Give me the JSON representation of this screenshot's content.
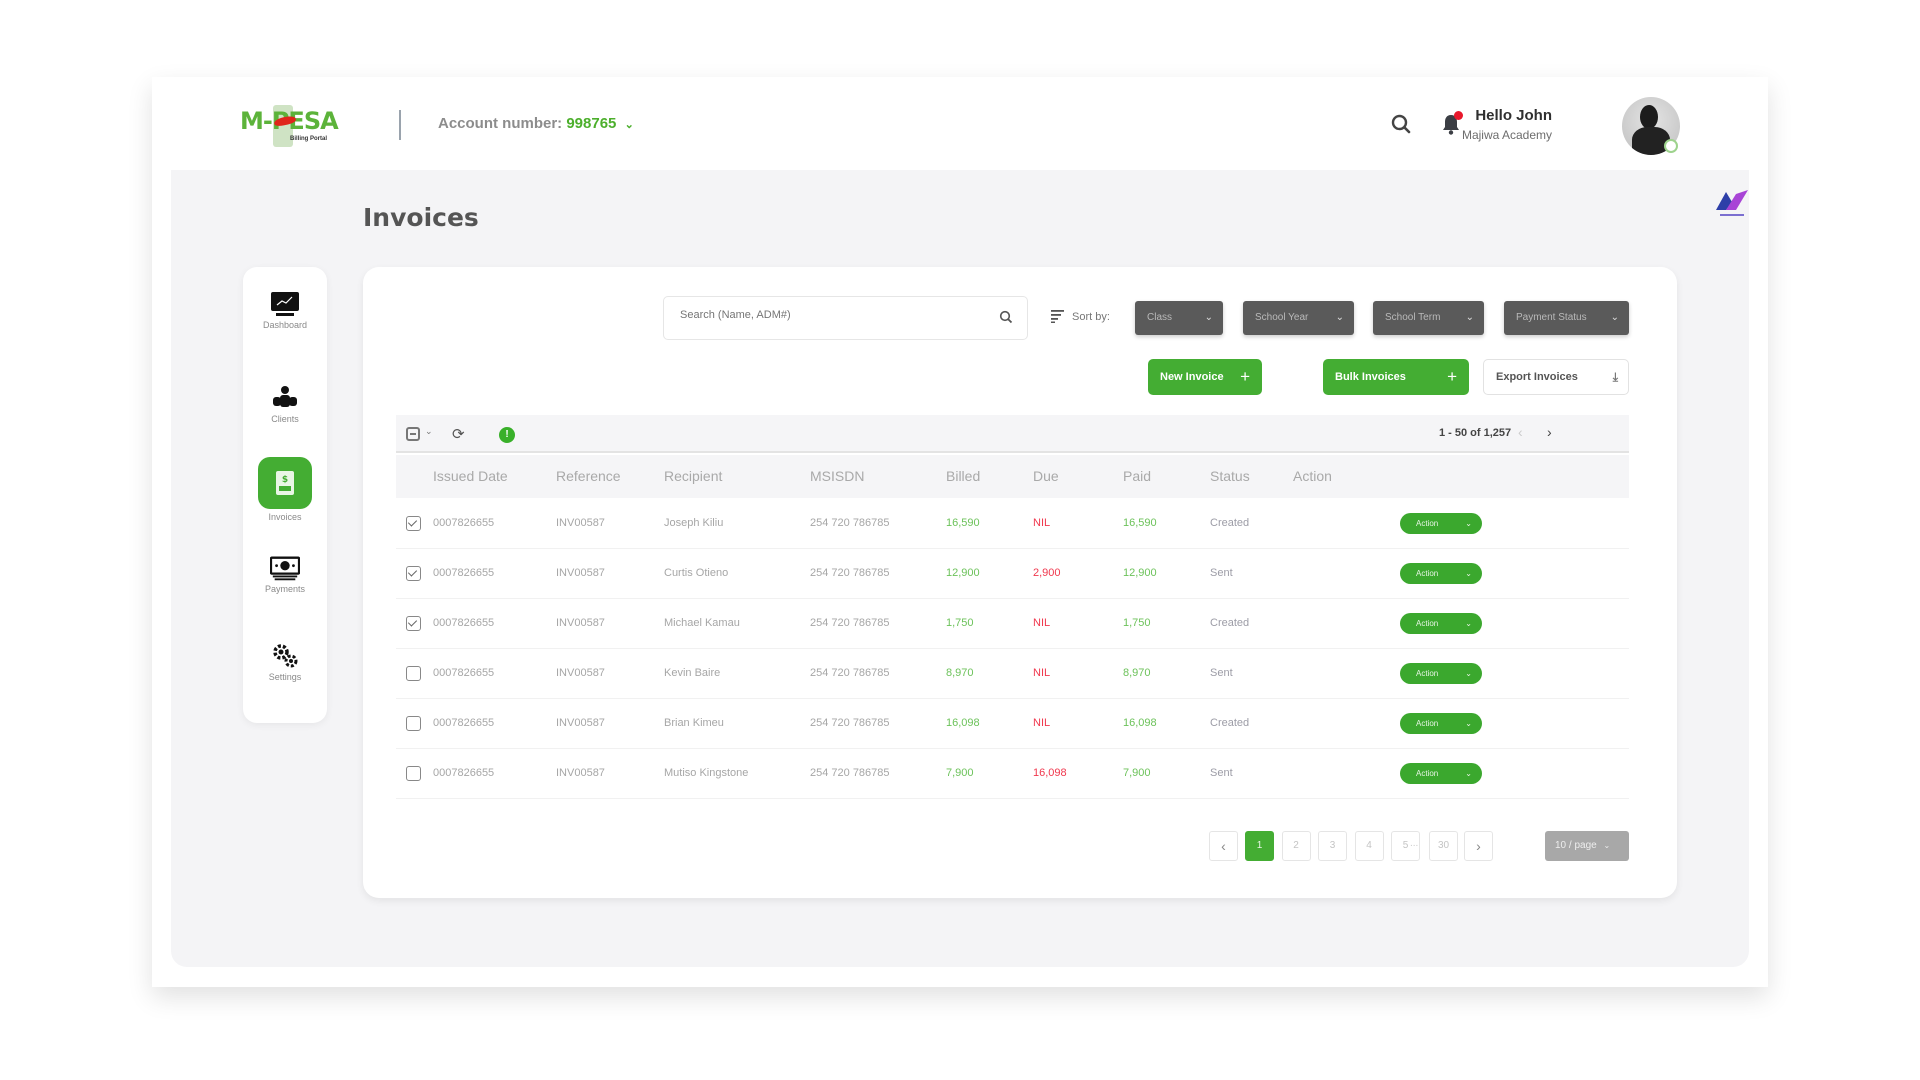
{
  "header": {
    "logo_text": "M-PESA",
    "logo_subtitle": "Billing Portal",
    "account_label": "Account number:",
    "account_number": "998765",
    "greeting": "Hello John",
    "organization": "Majiwa Academy"
  },
  "page": {
    "title": "Invoices"
  },
  "sidebar": {
    "items": [
      {
        "label": "Dashboard",
        "icon": "monitor-chart-icon",
        "active": false
      },
      {
        "label": "Clients",
        "icon": "clients-icon",
        "active": false
      },
      {
        "label": "Invoices",
        "icon": "invoice-document-icon",
        "active": true
      },
      {
        "label": "Payments",
        "icon": "cash-icon",
        "active": false
      },
      {
        "label": "Settings",
        "icon": "gears-icon",
        "active": false
      }
    ]
  },
  "toolbar": {
    "search_placeholder": "Search (Name, ADM#)",
    "sort_label": "Sort by:",
    "filters": [
      "Class",
      "School Year",
      "School Term",
      "Payment Status"
    ],
    "new_invoice": "New Invoice",
    "bulk_invoices": "Bulk Invoices",
    "export_invoices": "Export Invoices"
  },
  "table": {
    "range_text": "1 - 50 of 1,257",
    "columns": [
      "Issued Date",
      "Reference",
      "Recipient",
      "MSISDN",
      "Billed",
      "Due",
      "Paid",
      "Status",
      "Action"
    ],
    "rows": [
      {
        "checked": true,
        "date": "0007826655",
        "ref": "INV00587",
        "recipient": "Joseph Kiliu",
        "msisdn": "254 720 786785",
        "billed": "16,590",
        "due": "NIL",
        "paid": "16,590",
        "status": "Created",
        "action": "Action"
      },
      {
        "checked": true,
        "date": "0007826655",
        "ref": "INV00587",
        "recipient": "Curtis Otieno",
        "msisdn": "254 720 786785",
        "billed": "12,900",
        "due": "2,900",
        "paid": "12,900",
        "status": "Sent",
        "action": "Action"
      },
      {
        "checked": true,
        "date": "0007826655",
        "ref": "INV00587",
        "recipient": "Michael Kamau",
        "msisdn": "254 720 786785",
        "billed": "1,750",
        "due": "NIL",
        "paid": "1,750",
        "status": "Created",
        "action": "Action"
      },
      {
        "checked": false,
        "date": "0007826655",
        "ref": "INV00587",
        "recipient": "Kevin Baire",
        "msisdn": "254 720 786785",
        "billed": "8,970",
        "due": "NIL",
        "paid": "8,970",
        "status": "Sent",
        "action": "Action"
      },
      {
        "checked": false,
        "date": "0007826655",
        "ref": "INV00587",
        "recipient": "Brian Kimeu",
        "msisdn": "254 720 786785",
        "billed": "16,098",
        "due": "NIL",
        "paid": "16,098",
        "status": "Created",
        "action": "Action"
      },
      {
        "checked": false,
        "date": "0007826655",
        "ref": "INV00587",
        "recipient": "Mutiso Kingstone",
        "msisdn": "254 720 786785",
        "billed": "7,900",
        "due": "16,098",
        "paid": "7,900",
        "status": "Sent",
        "action": "Action"
      }
    ]
  },
  "pagination": {
    "pages": [
      "1",
      "2",
      "3",
      "4",
      "5"
    ],
    "ellipsis": "...",
    "last_page": "30",
    "current": "1",
    "per_page": "10 / page"
  },
  "colors": {
    "brand_green": "#44ad33",
    "due_red": "#f0384e",
    "dropdown_gray": "#5a5a5a"
  }
}
